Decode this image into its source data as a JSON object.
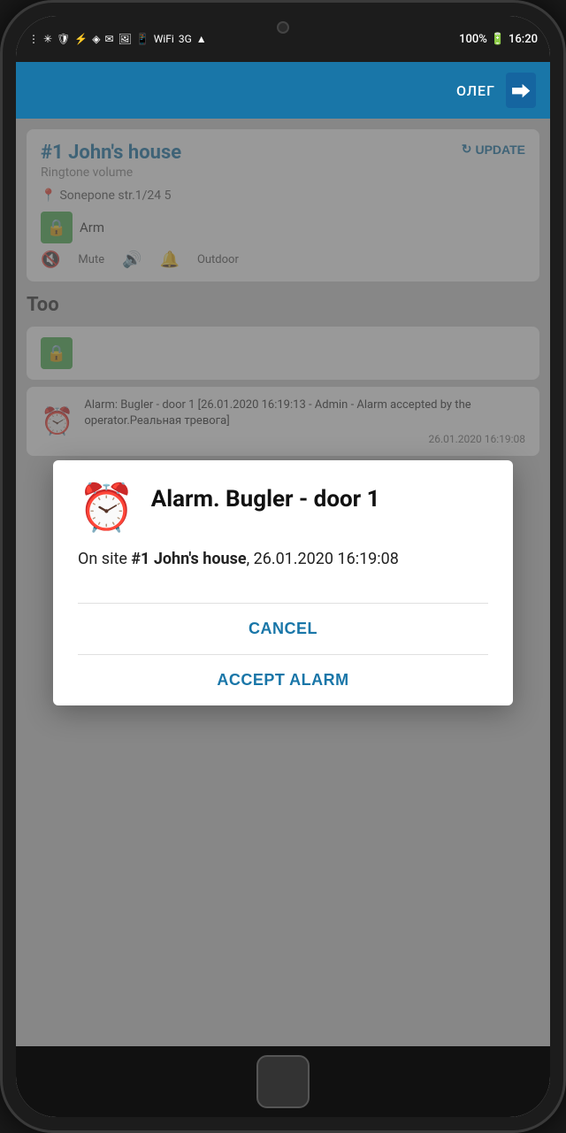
{
  "phone": {
    "status_bar": {
      "time": "16:20",
      "battery": "100%",
      "signal": "3G"
    },
    "header": {
      "user_label": "ОЛЕГ",
      "logout_icon": "exit"
    },
    "site_card": {
      "number": "#1",
      "name": "John's house",
      "subtitle": "Ringtone volume",
      "update_label": "UPDATE",
      "address": "Sonepone str.1/24 5",
      "arm_label": "Arm",
      "mute_label": "Mute",
      "outdoor_label": "Outdoor"
    },
    "tools_section": {
      "title": "Too",
      "alarm_log": "Alarm: Bugler - door 1 [26.01.2020 16:19:13 - Admin - Alarm accepted by the operator.Реальная тревога]",
      "alarm_timestamp": "26.01.2020 16:19:08"
    },
    "dialog": {
      "title": "Alarm. Bugler - door 1",
      "body_prefix": "On site ",
      "body_site": "#1 John's house",
      "body_datetime": ", 26.01.2020 16:19:08",
      "cancel_label": "CANCEL",
      "accept_label": "ACCEPT ALARM"
    }
  }
}
